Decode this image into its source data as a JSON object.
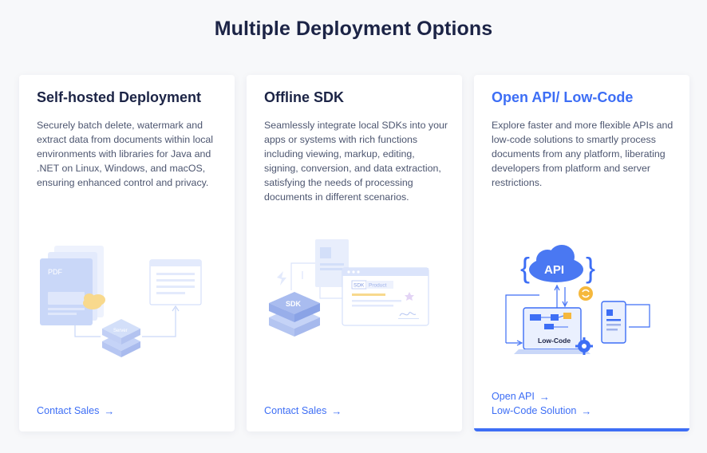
{
  "section": {
    "title": "Multiple Deployment Options"
  },
  "cards": [
    {
      "title": "Self-hosted Deployment",
      "description": "Securely batch delete, watermark and extract data from documents within local environments with libraries for Java and .NET on Linux, Windows, and macOS, ensuring enhanced control and privacy.",
      "illustration": {
        "doc_label": "PDF",
        "server_label": "Server"
      },
      "links": [
        {
          "label": "Contact Sales",
          "icon": "arrow-right-icon"
        }
      ]
    },
    {
      "title": "Offline SDK",
      "description": "Seamlessly integrate local SDKs into your apps or systems with rich functions including viewing, markup, editing, signing, conversion, and data extraction, satisfying the needs of processing documents in different scenarios.",
      "illustration": {
        "sdk_label": "SDK",
        "tag_sdk": "SDK",
        "tag_product": "Product"
      },
      "links": [
        {
          "label": "Contact Sales",
          "icon": "arrow-right-icon"
        }
      ]
    },
    {
      "title": "Open API/ Low-Code",
      "description": "Explore faster and more flexible APIs and low-code solutions to smartly process documents from any platform, liberating developers from platform and server restrictions.",
      "illustration": {
        "api_label": "API",
        "lowcode_label": "Low-Code",
        "brace_left": "{",
        "brace_right": "}"
      },
      "links": [
        {
          "label": "Open API",
          "icon": "arrow-right-icon"
        },
        {
          "label": "Low-Code Solution",
          "icon": "arrow-right-icon"
        }
      ]
    }
  ],
  "colors": {
    "accent": "#3d6ef5",
    "title": "#1c2446",
    "body_text": "#4d5670",
    "background": "#f7f8fa",
    "card": "#ffffff",
    "illustration_light": "#dbe4fb",
    "illustration_orange": "#f5b83d"
  }
}
